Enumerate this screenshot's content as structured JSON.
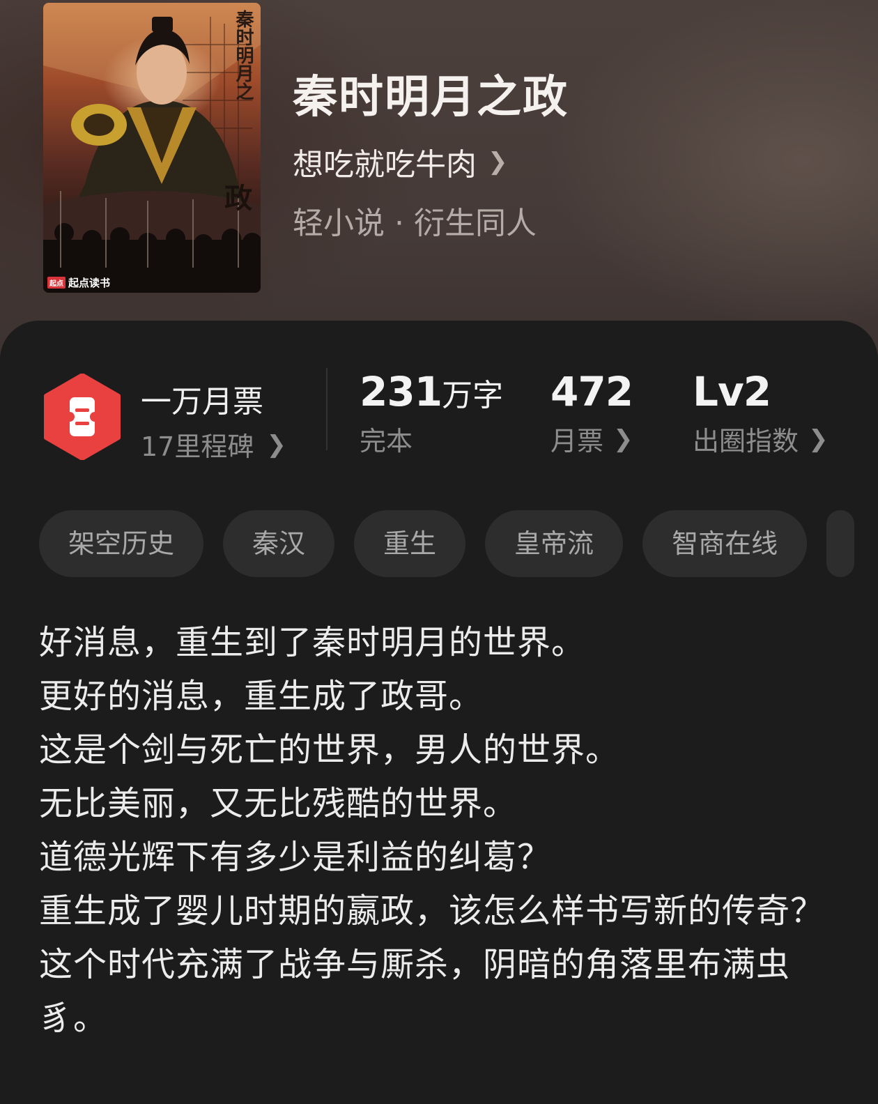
{
  "book": {
    "title": "秦时明月之政",
    "author": "想吃就吃牛肉",
    "genre": "轻小说 · 衍生同人",
    "cover": {
      "title_text": "秦时明月之",
      "seal_text": "政",
      "brand": "起点读书",
      "brand_tag": "起点"
    }
  },
  "stats": {
    "badge_main": "一万月票",
    "badge_sub": "17里程碑",
    "word_count_num": "231",
    "word_count_unit": "万字",
    "word_count_label": "完本",
    "monthly_votes_num": "472",
    "monthly_votes_label": "月票",
    "popularity_num": "Lv2",
    "popularity_label": "出圈指数"
  },
  "tags": [
    "架空历史",
    "秦汉",
    "重生",
    "皇帝流",
    "智商在线"
  ],
  "synopsis": [
    "好消息，重生到了秦时明月的世界。",
    "更好的消息，重生成了政哥。",
    "这是个剑与死亡的世界，男人的世界。",
    "无比美丽，又无比残酷的世界。",
    "道德光辉下有多少是利益的纠葛？",
    "重生成了婴儿时期的嬴政，该怎么样书写新的传奇？",
    "这个时代充满了战争与厮杀，阴暗的角落里布满虫豸。"
  ],
  "colors": {
    "badge_red": "#e8413f",
    "card_bg": "#1c1c1c",
    "tag_bg": "#2d2d2d"
  }
}
